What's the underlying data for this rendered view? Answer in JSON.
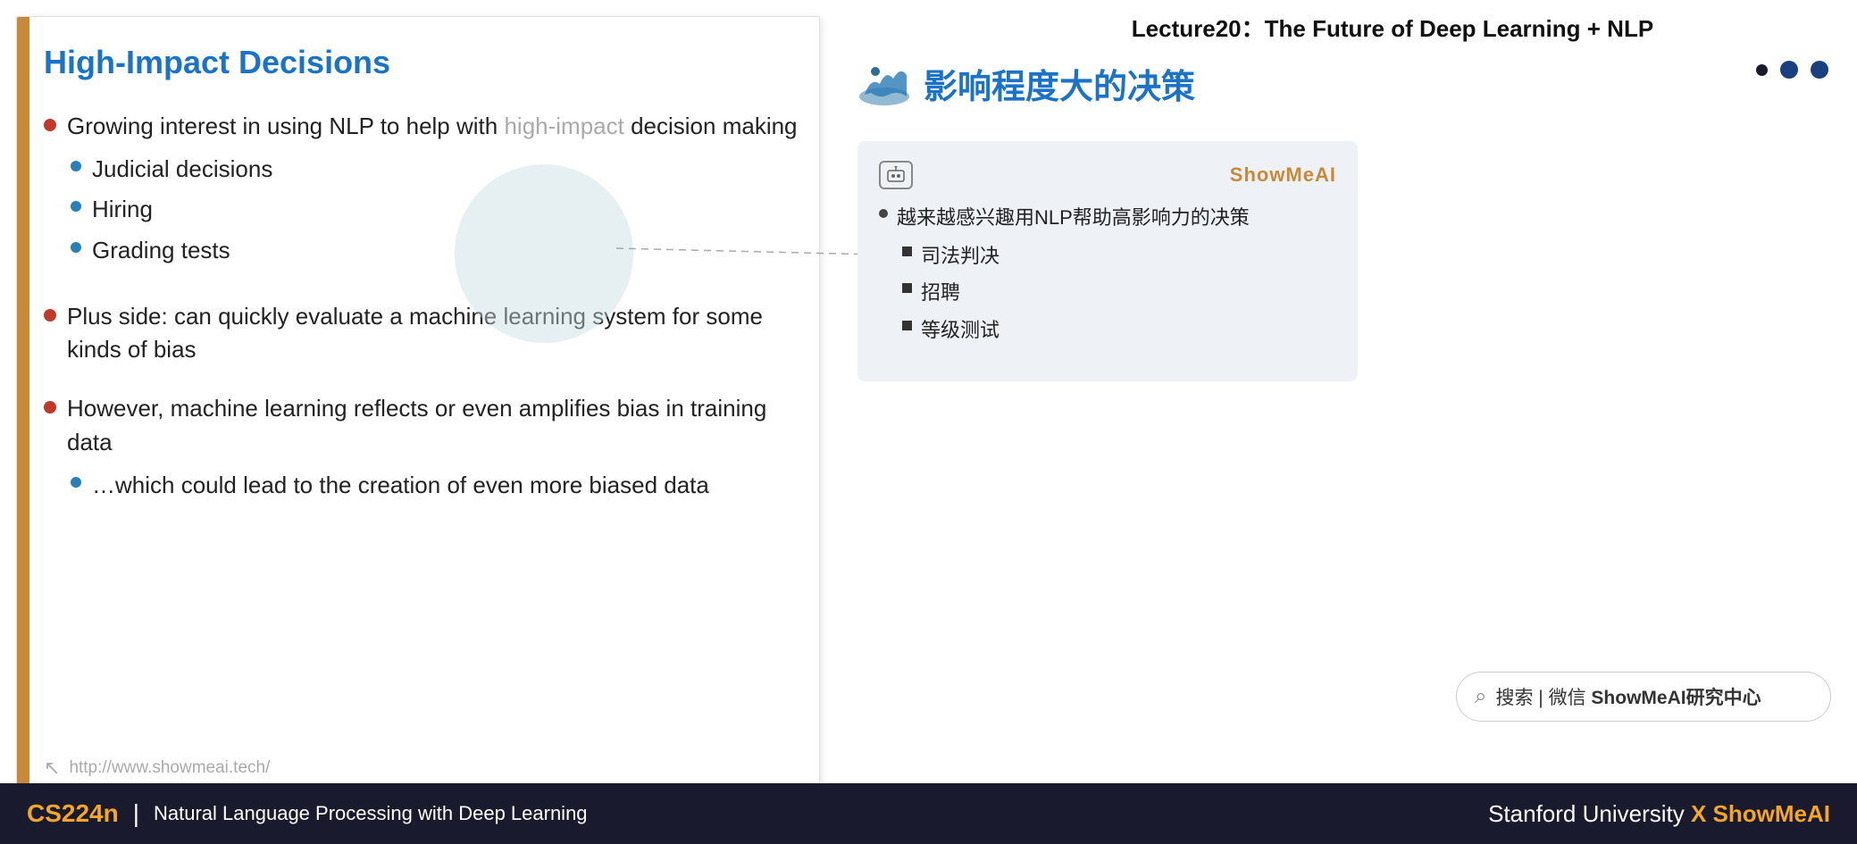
{
  "header": {
    "title": "Lecture20：The Future of Deep Learning + NLP"
  },
  "slide": {
    "title": "High-Impact Decisions",
    "bullets": [
      {
        "text": "Growing interest in using NLP to help with high-impact decision making",
        "sub": [
          "Judicial decisions",
          "Hiring",
          "Grading tests"
        ]
      },
      {
        "text": "Plus side: can quickly evaluate a machine learning system for some kinds of bias",
        "sub": []
      },
      {
        "text": "However, machine learning reflects or even amplifies bias in training data",
        "sub": [
          "…which could lead to the creation of even more biased data"
        ]
      }
    ],
    "footer_url": "http://www.showmeai.tech/"
  },
  "right": {
    "chinese_title": "影响程度大的决策",
    "brand": "ShowMeAI",
    "translation_box": {
      "main_bullet": "越来越感兴趣用NLP帮助高影响力的决策",
      "sub_bullets": [
        "司法判决",
        "招聘",
        "等级测试"
      ]
    }
  },
  "search": {
    "text": "🔍 搜索 | 微信 ShowMeAI研究中心"
  },
  "footer": {
    "course": "CS224n",
    "desc": "Natural Language Processing with Deep Learning",
    "right": "Stanford University",
    "brand_suffix": "X ShowMeAI"
  },
  "nav_dots": {
    "dot1": "small",
    "dot2": "active",
    "dot3": "active"
  }
}
